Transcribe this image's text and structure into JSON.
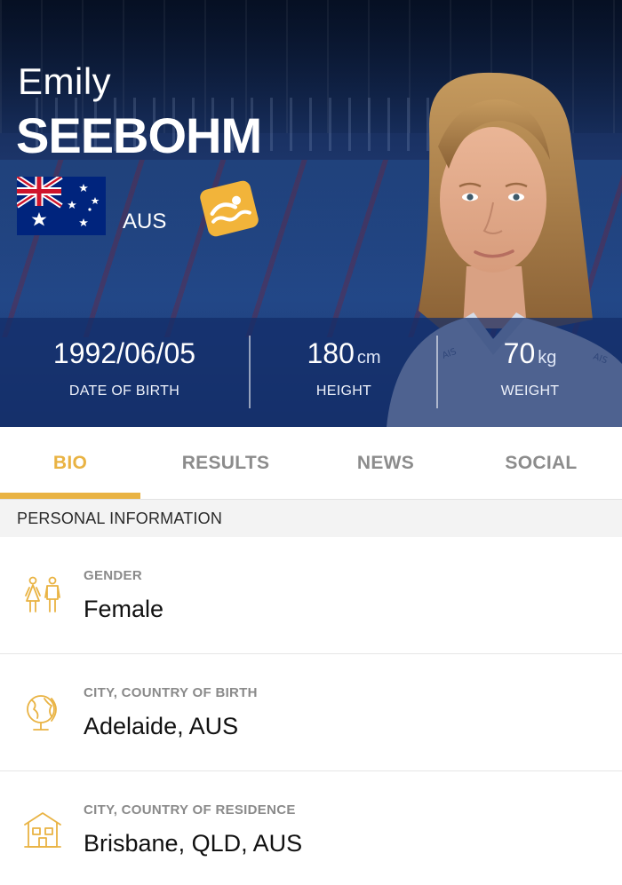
{
  "athlete": {
    "first_name": "Emily",
    "last_name": "SEEBOHM",
    "country_code": "AUS",
    "flag_icon": "australia-flag-icon",
    "sport_icon": "swimming-icon"
  },
  "stats": [
    {
      "value": "1992/06/05",
      "unit": "",
      "label": "DATE OF BIRTH"
    },
    {
      "value": "180",
      "unit": "cm",
      "label": "HEIGHT"
    },
    {
      "value": "70",
      "unit": "kg",
      "label": "WEIGHT"
    }
  ],
  "tabs": [
    {
      "label": "BIO",
      "active": true
    },
    {
      "label": "RESULTS",
      "active": false
    },
    {
      "label": "NEWS",
      "active": false
    },
    {
      "label": "SOCIAL",
      "active": false
    }
  ],
  "section": {
    "title": "PERSONAL INFORMATION"
  },
  "info": [
    {
      "icon": "gender-icon",
      "label": "GENDER",
      "value": "Female"
    },
    {
      "icon": "globe-icon",
      "label": "CITY, COUNTRY OF BIRTH",
      "value": "Adelaide, AUS"
    },
    {
      "icon": "house-icon",
      "label": "CITY, COUNTRY OF RESIDENCE",
      "value": "Brisbane, QLD, AUS"
    }
  ],
  "colors": {
    "accent": "#e9b343",
    "hero_blue": "#1b3366",
    "tab_inactive": "#8c8c8c"
  }
}
